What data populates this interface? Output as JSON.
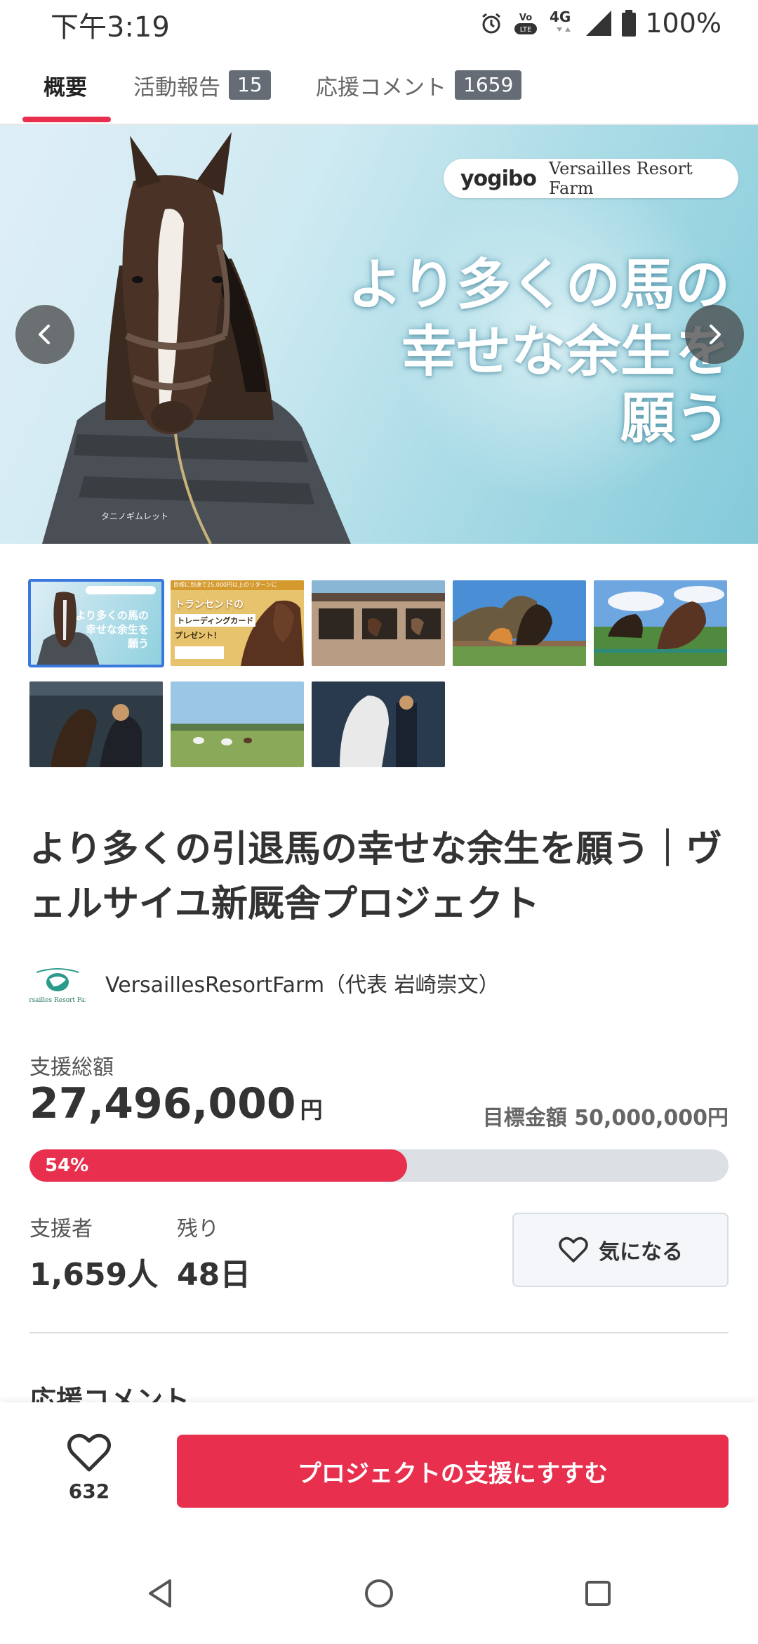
{
  "status_bar": {
    "time": "下午3:19",
    "battery": "100%",
    "network": "4G",
    "volte": "VoLTE"
  },
  "tabs": [
    {
      "label": "概要",
      "badge": ""
    },
    {
      "label": "活動報告",
      "badge": "15"
    },
    {
      "label": "応援コメント",
      "badge": "1659"
    }
  ],
  "hero": {
    "brand_logo": "yogibo",
    "brand_farm": "Versailles Resort Farm",
    "headline": "より多くの馬の\n幸せな余生を\n願う",
    "caption": "タニノギムレット",
    "prev_icon": "chevron-left-icon",
    "next_icon": "chevron-right-icon"
  },
  "thumbnails": {
    "selected_index": 0,
    "second_thumb_headline": "トランセンドの",
    "second_thumb_sub": "トレーディングカード",
    "second_thumb_badge": "プレゼント！",
    "second_thumb_banner": "目標に到達で25,000円以上のリターンに"
  },
  "project": {
    "title": "より多くの引退馬の幸せな余生を願う｜ヴェルサイユ新厩舎プロジェクト",
    "owner": "VersaillesResortFarm（代表 岩崎崇文）",
    "owner_logo_text": "Versailles Resort Farm"
  },
  "funding": {
    "total_label": "支援総額",
    "total_amount": "27,496,000",
    "total_unit": "円",
    "goal_text": "目標金額 50,000,000円",
    "progress_percent": 54,
    "progress_label": "54%",
    "supporters_label": "支援者",
    "supporters_value": "1,659人",
    "remaining_label": "残り",
    "remaining_value": "48日",
    "watch_label": "気になる"
  },
  "comments_heading": "応援コメント",
  "bottom_bar": {
    "like_count": "632",
    "support_button": "プロジェクトの支援にすすむ"
  },
  "colors": {
    "accent": "#e8304e",
    "badge": "#666c75",
    "progress_track": "#dcdfe4"
  }
}
